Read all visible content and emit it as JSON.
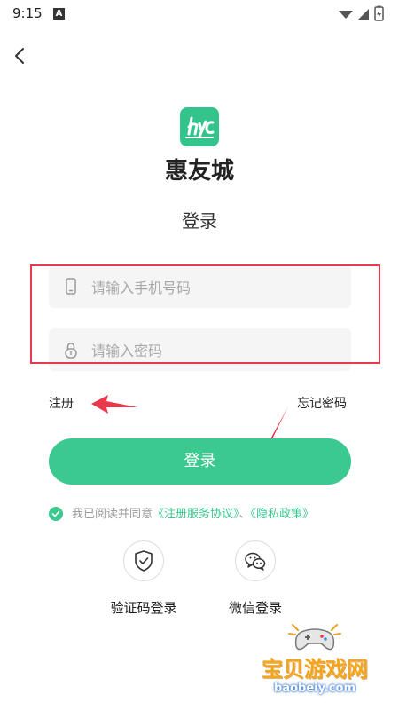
{
  "status_bar": {
    "time": "9:15",
    "notification_letter": "A"
  },
  "app": {
    "name": "惠友城",
    "logo_text": "hyc",
    "brand_color": "#33c48c"
  },
  "page": {
    "subtitle": "登录"
  },
  "form": {
    "phone_placeholder": "请输入手机号码",
    "password_placeholder": "请输入密码"
  },
  "links": {
    "register": "注册",
    "forgot_password": "忘记密码"
  },
  "login_button": {
    "label": "登录",
    "color": "#3cc98f"
  },
  "agreement": {
    "prefix": "我已阅读并同意",
    "service_agreement": "《注册服务协议》",
    "separator": "、",
    "privacy_policy": "《隐私政策》"
  },
  "alt_login": [
    {
      "label": "验证码登录",
      "icon": "shield-check-icon"
    },
    {
      "label": "微信登录",
      "icon": "wechat-icon"
    }
  ],
  "watermark": {
    "title": "宝贝游戏网",
    "url": "baobeiy.com"
  },
  "annotation_color": "#e83a4c"
}
